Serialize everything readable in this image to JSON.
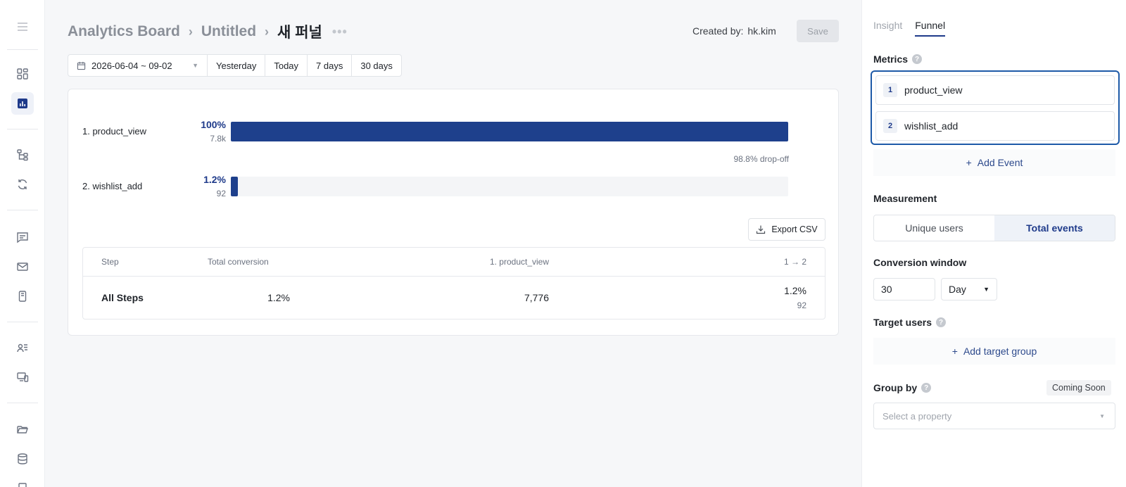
{
  "breadcrumb": {
    "board": "Analytics Board",
    "page": "Untitled",
    "current": "새 퍼널",
    "more": "•••"
  },
  "header": {
    "created_label": "Created by:",
    "created_by": "hk.kim",
    "save_label": "Save"
  },
  "date_filter": {
    "range": "2026-06-04 ~ 09-02",
    "presets": [
      "Yesterday",
      "Today",
      "7 days",
      "30 days"
    ]
  },
  "funnel": {
    "steps": [
      {
        "label": "1. product_view",
        "percent_text": "100%",
        "count_text": "7.8k",
        "fraction": 1.0
      },
      {
        "label": "2. wishlist_add",
        "percent_text": "1.2%",
        "count_text": "92",
        "fraction": 0.012
      }
    ],
    "dropoff": "98.8% drop-off",
    "export_label": "Export CSV"
  },
  "table": {
    "headers": [
      "Step",
      "Total conversion",
      "1. product_view",
      "1 → 2"
    ],
    "row": {
      "step": "All Steps",
      "total_conversion": "1.2%",
      "step1_value": "7,776",
      "step2_percent": "1.2%",
      "step2_count": "92"
    }
  },
  "panel": {
    "tabs": [
      {
        "label": "Insight",
        "active": false
      },
      {
        "label": "Funnel",
        "active": true
      }
    ],
    "metrics_title": "Metrics",
    "metrics": [
      {
        "num": "1",
        "name": "product_view"
      },
      {
        "num": "2",
        "name": "wishlist_add"
      }
    ],
    "add_event": "Add Event",
    "measurement_title": "Measurement",
    "measurement_options": [
      "Unique users",
      "Total events"
    ],
    "measurement_selected": "Total events",
    "conversion_window_title": "Conversion window",
    "conversion_window_value": "30",
    "conversion_window_unit": "Day",
    "target_users_title": "Target users",
    "add_target_group": "Add target group",
    "group_by_title": "Group by",
    "coming_soon": "Coming Soon",
    "property_placeholder": "Select a property"
  },
  "colors": {
    "accent": "#1e3a8a",
    "bar_fill": "#1e408c",
    "focus_border": "#1e5aa8"
  }
}
